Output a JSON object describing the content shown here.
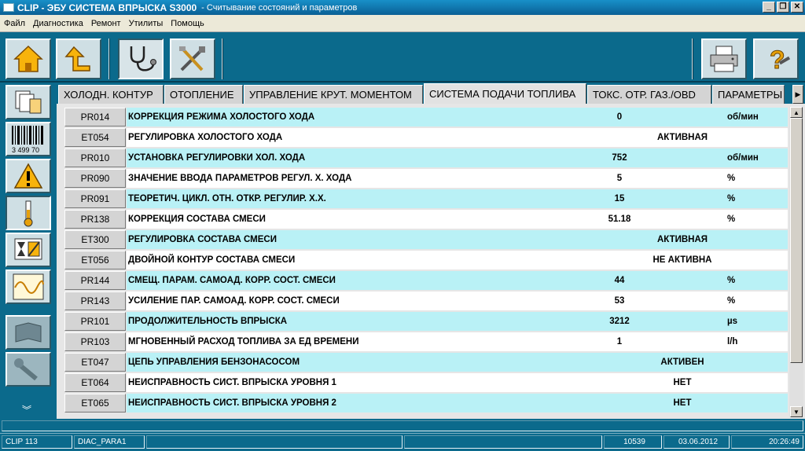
{
  "window": {
    "title_main": "CLIP - ЭБУ СИСТЕМА ВПРЫСКА S3000",
    "title_sub": "- Считывание состояний и параметров",
    "controls": [
      "_",
      "❐",
      "✕"
    ]
  },
  "menu": [
    "Файл",
    "Диагностика",
    "Ремонт",
    "Утилиты",
    "Помощь"
  ],
  "toolbar": {
    "left": [
      "home-icon",
      "back-arrow-icon",
      "stethoscope-icon",
      "tools-icon"
    ],
    "right": [
      "printer-icon",
      "help-icon"
    ]
  },
  "sidebar": [
    "documents-icon",
    "barcode-icon",
    "warning-icon",
    "thermometer-icon",
    "actuator-icon",
    "oscilloscope-icon",
    "manual-icon",
    "wrench-icon"
  ],
  "barcode_text": "3 499 70",
  "tabs": [
    {
      "label": "ХОЛОДН. КОНТУР",
      "active": false
    },
    {
      "label": "ОТОПЛЕНИЕ",
      "active": false
    },
    {
      "label": "УПРАВЛЕНИЕ КРУТ. МОМЕНТОМ",
      "active": false
    },
    {
      "label": "СИСТЕМА ПОДАЧИ ТОПЛИВА",
      "active": true
    },
    {
      "label": "ТОКС. ОТР. ГАЗ./OBD",
      "active": false
    },
    {
      "label": "ПАРАМЕТРЫ",
      "active": false
    }
  ],
  "rows": [
    {
      "code": "PR014",
      "label": "КОРРЕКЦИЯ РЕЖИМА ХОЛОСТОГО ХОДА",
      "value": "0",
      "unit": "об/мин"
    },
    {
      "code": "ET054",
      "label": "РЕГУЛИРОВКА ХОЛОСТОГО ХОДА",
      "value": "АКТИВНАЯ",
      "unit": ""
    },
    {
      "code": "PR010",
      "label": "УСТАНОВКА РЕГУЛИРОВКИ ХОЛ. ХОДА",
      "value": "752",
      "unit": "об/мин"
    },
    {
      "code": "PR090",
      "label": "ЗНАЧЕНИЕ ВВОДА ПАРАМЕТРОВ РЕГУЛ. Х. ХОДА",
      "value": "5",
      "unit": "%"
    },
    {
      "code": "PR091",
      "label": "ТЕОРЕТИЧ. ЦИКЛ. ОТН. ОТКР. РЕГУЛИР. Х.Х.",
      "value": "15",
      "unit": "%"
    },
    {
      "code": "PR138",
      "label": "КОРРЕКЦИЯ СОСТАВА СМЕСИ",
      "value": "51.18",
      "unit": "%"
    },
    {
      "code": "ET300",
      "label": "РЕГУЛИРОВКА СОСТАВА СМЕСИ",
      "value": "АКТИВНАЯ",
      "unit": ""
    },
    {
      "code": "ET056",
      "label": "ДВОЙНОЙ КОНТУР СОСТАВА СМЕСИ",
      "value": "НЕ АКТИВНА",
      "unit": ""
    },
    {
      "code": "PR144",
      "label": "СМЕЩ. ПАРАМ. САМОАД. КОРР. СОСТ. СМЕСИ",
      "value": "44",
      "unit": "%"
    },
    {
      "code": "PR143",
      "label": "УСИЛЕНИЕ ПАР. САМОАД. КОРР. СОСТ. СМЕСИ",
      "value": "53",
      "unit": "%"
    },
    {
      "code": "PR101",
      "label": "ПРОДОЛЖИТЕЛЬНОСТЬ ВПРЫСКА",
      "value": "3212",
      "unit": "µs"
    },
    {
      "code": "PR103",
      "label": "МГНОВЕННЫЙ РАСХОД ТОПЛИВА ЗА ЕД ВРЕМЕНИ",
      "value": "1",
      "unit": "l/h"
    },
    {
      "code": "ET047",
      "label": "ЦЕПЬ УПРАВЛЕНИЯ БЕНЗОНАСОСОМ",
      "value": "АКТИВЕН",
      "unit": ""
    },
    {
      "code": "ET064",
      "label": "НЕИСПРАВНОСТЬ СИСТ. ВПРЫСКА УРОВНЯ 1",
      "value": "НЕТ",
      "unit": ""
    },
    {
      "code": "ET065",
      "label": "НЕИСПРАВНОСТЬ СИСТ. ВПРЫСКА УРОВНЯ 2",
      "value": "НЕТ",
      "unit": ""
    }
  ],
  "status": {
    "device": "CLIP 113",
    "mode": "DIAC_PARA1",
    "field3": "",
    "field4": "",
    "count": "10539",
    "date": "03.06.2012",
    "time": "20:26:49"
  }
}
